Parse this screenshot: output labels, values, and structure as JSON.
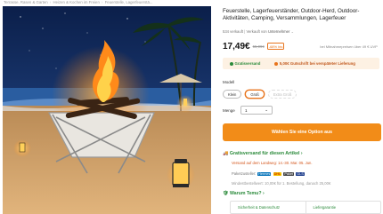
{
  "breadcrumb": [
    "Terrasse, Rasen & Garten",
    "Heizen & Kochen im Freien",
    "Feuerstelle, Lagerfeuerstä..."
  ],
  "product": {
    "title": "Feuerstelle, Lagerfeuerständer, Outdoor-Herd, Outdoor-Aktivitäten, Camping, Versammlungen, Lagerfeuer",
    "sold": "534 verkauft",
    "sold_by_prefix": "Verkauft von",
    "seller": "Unternehmer",
    "price": "17,49€",
    "old_price": "55,09€",
    "discount": "-68% bis",
    "mwst_note": "inkl. MwSt.",
    "price_note": "bei Mitnahmepreisen über 49 € UVP"
  },
  "promo": {
    "free_shipping": "Gratisversand",
    "credit": "5,00€ Gutschrift bei verspäteter Lieferung"
  },
  "variants": {
    "label": "Modell",
    "options": [
      "Klein",
      "Groß",
      "Extra Groß"
    ],
    "selected_index": 1
  },
  "quantity": {
    "label": "Menge",
    "value": "1"
  },
  "cta_label": "Wählen Sie eine Option aus",
  "shipping": {
    "title": "Gratisversand für diesen Artikel",
    "delivery": "Versand auf dem Landweg: 14.-30. Mar. 05. Jun.",
    "partners_label": "Paketzusteller:",
    "partners": [
      "Hermes",
      "DHL",
      "Paket",
      "GLS"
    ],
    "min_order": "Mindestbestellwert: 10,00€ für 1. Bestellung, danach 25,00€"
  },
  "why": {
    "title": "Warum Temu?",
    "items": [
      "Sicherheit & Datenschutz",
      "Liefergarantie"
    ]
  },
  "colors": {
    "accent": "#f28c18",
    "green": "#2a8a3a",
    "promo_bg": "#fdf1e3"
  }
}
